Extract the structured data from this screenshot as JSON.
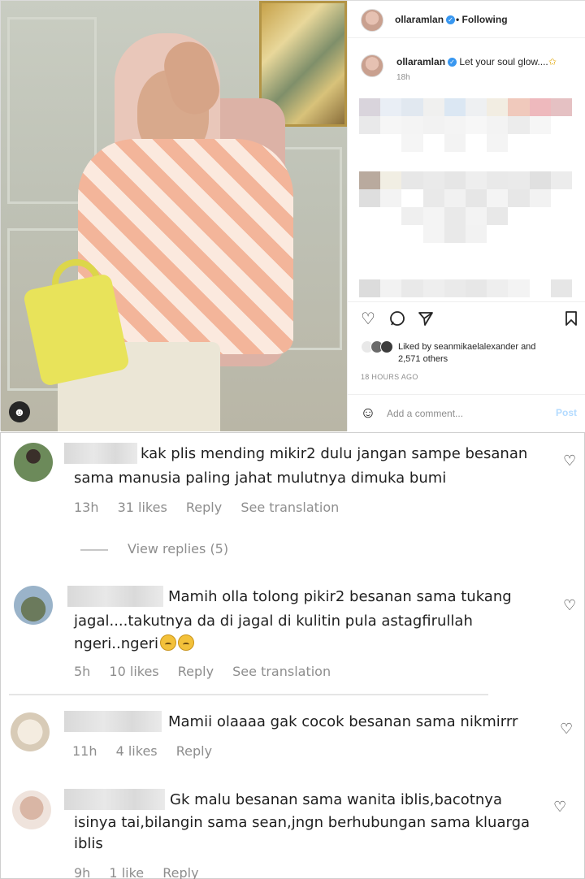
{
  "post": {
    "username": "ollaramlan",
    "follow_status": "Following",
    "dot": "•",
    "verified_mark": "✓",
    "caption": "Let your soul glow....",
    "caption_emoji": "✩",
    "caption_time": "18h",
    "liked_by_prefix": "Liked by",
    "liked_by_user": "seanmikaelalexander",
    "liked_by_and": "and",
    "liked_by_others": "2,571 others",
    "posted_ago": "18 HOURS AGO",
    "comment_placeholder": "Add a comment...",
    "post_label": "Post",
    "icons": {
      "like": "heart-icon",
      "comment": "comment-icon",
      "share": "share-icon",
      "save": "bookmark-icon",
      "emoji": "smiley-icon",
      "tag": "user-tag-icon"
    },
    "pixel_rows_top": [
      [
        "#d9d4dc",
        "#e9eef5",
        "#e1e8f0",
        "#f0f0ef",
        "#dbe7f3",
        "#eef0f2",
        "#f2ede2",
        "#f0c9bc",
        "#eeb9bd",
        "#e5c1c3"
      ],
      [
        "#e9e9ea",
        "#f6f6f6",
        "#f4f4f4",
        "#f2f2f2",
        "#f4f4f4",
        "#f7f7f7",
        "#f3f3f3",
        "#ececec",
        "#f6f6f6",
        "#ffffff"
      ],
      [
        "#ffffff",
        "#ffffff",
        "#f5f5f5",
        "#ffffff",
        "#f3f3f3",
        "#ffffff",
        "#f4f4f4",
        "#ffffff",
        "#ffffff",
        "#ffffff"
      ]
    ],
    "pixel_rows_mid": [
      [
        "#b9aa9e",
        "#f1eee3",
        "#e7e7e7",
        "#eaeaea",
        "#e6e6e6",
        "#eeeeee",
        "#e9e9e9",
        "#eaeaea",
        "#e0e0e0",
        "#ececec"
      ],
      [
        "#dedede",
        "#f3f3f3",
        "#ffffff",
        "#e9e9e9",
        "#f1f1f1",
        "#e6e6e6",
        "#f4f4f4",
        "#e7e7e7",
        "#f2f2f2",
        "#ffffff"
      ],
      [
        "#ffffff",
        "#ffffff",
        "#efefef",
        "#f4f4f4",
        "#e9e9e9",
        "#f3f3f3",
        "#e8e8e8",
        "#ffffff",
        "#ffffff",
        "#ffffff"
      ],
      [
        "#ffffff",
        "#ffffff",
        "#ffffff",
        "#f4f4f4",
        "#e9e9e9",
        "#f2f2f2",
        "#ffffff",
        "#ffffff",
        "#ffffff",
        "#ffffff"
      ]
    ],
    "pixel_rows_bottom": [
      [
        "#dcdcdc",
        "#f2f2f2",
        "#e9e9e9",
        "#eeeeee",
        "#eaeaea",
        "#e7e7e7",
        "#eeeeee",
        "#f3f3f3",
        "#ffffff",
        "#e6e6e6"
      ]
    ]
  },
  "comments": [
    {
      "line1": "kak plis mending mikir2 dulu jangan sampe besanan",
      "line2": "sama manusia paling jahat mulutnya dimuka bumi",
      "time": "13h",
      "likes": "31 likes",
      "reply": "Reply",
      "translate": "See translation",
      "view_replies": "View replies (5)"
    },
    {
      "line1": "Mamih olla tolong pikir2 besanan sama tukang",
      "line2": "jagal....takutnya da di jagal di kulitin pula astagfirullah",
      "line3": "ngeri..ngeri",
      "time": "5h",
      "likes": "10 likes",
      "reply": "Reply",
      "translate": "See translation"
    },
    {
      "line1": "Mamii olaaaa gak cocok besanan sama nikmirrr",
      "time": "11h",
      "likes": "4 likes",
      "reply": "Reply"
    },
    {
      "line1": "Gk malu besanan sama wanita iblis,bacotnya",
      "line2": "isinya tai,bilangin sama sean,jngn berhubungan sama kluarga",
      "line3": "iblis",
      "time": "9h",
      "likes": "1 like",
      "reply": "Reply"
    }
  ],
  "comment_icons": {
    "like": "heart-outline-icon"
  }
}
